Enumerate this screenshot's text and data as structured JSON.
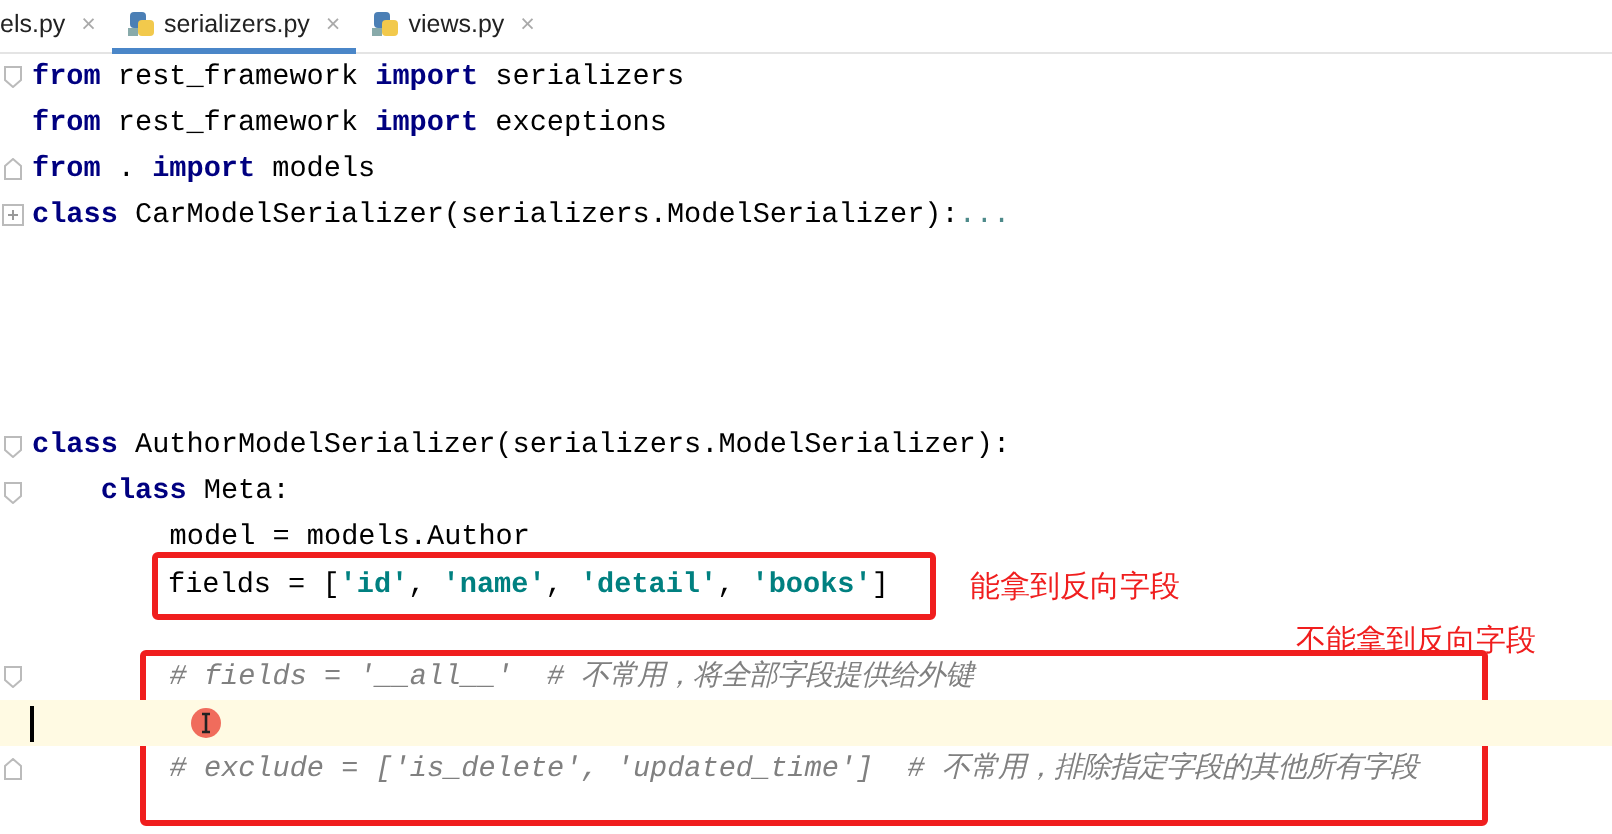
{
  "tabs": [
    {
      "label": "els.py",
      "selected": false,
      "close": "×"
    },
    {
      "label": "serializers.py",
      "selected": true,
      "icon": true,
      "close": "×"
    },
    {
      "label": "views.py",
      "selected": false,
      "icon": true,
      "close": "×"
    }
  ],
  "editor": {
    "lines": [
      {
        "kind": "code",
        "fold_start": true,
        "tokens": [
          {
            "kind": "kw",
            "text": "from"
          },
          {
            "kind": "plain",
            "text": " rest_framework "
          },
          {
            "kind": "kw",
            "text": "import"
          },
          {
            "kind": "plain",
            "text": " serializers"
          }
        ]
      },
      {
        "kind": "code",
        "tokens": [
          {
            "kind": "kw",
            "text": "from"
          },
          {
            "kind": "plain",
            "text": " rest_framework "
          },
          {
            "kind": "kw",
            "text": "import"
          },
          {
            "kind": "plain",
            "text": " exceptions"
          }
        ]
      },
      {
        "kind": "code",
        "fold_end": true,
        "tokens": [
          {
            "kind": "kw",
            "text": "from"
          },
          {
            "kind": "plain",
            "text": " . "
          },
          {
            "kind": "kw",
            "text": "import"
          },
          {
            "kind": "plain",
            "text": " models"
          }
        ]
      },
      {
        "kind": "code",
        "collapsed": true,
        "tokens": [
          {
            "kind": "kw",
            "text": "class"
          },
          {
            "kind": "plain",
            "text": " CarModelSerializer(serializers.ModelSerializer):"
          },
          {
            "kind": "folded",
            "text": "..."
          }
        ]
      },
      {
        "kind": "blank"
      },
      {
        "kind": "blank"
      },
      {
        "kind": "blank"
      },
      {
        "kind": "blank"
      },
      {
        "kind": "code",
        "fold_start": true,
        "tokens": [
          {
            "kind": "kw",
            "text": "class"
          },
          {
            "kind": "plain",
            "text": " AuthorModelSerializer(serializers.ModelSerializer):"
          }
        ],
        "children": [
          {
            "kind": "code",
            "fold_start": true,
            "tokens": [
              {
                "kind": "kw",
                "text": "class"
              },
              {
                "kind": "plain",
                "text": " Meta:"
              }
            ],
            "children": [
              {
                "kind": "code",
                "tokens": [
                  {
                    "kind": "plain",
                    "text": "model = models.Author"
                  }
                ]
              },
              {
                "kind": "code",
                "annotation": {
                  "label": "能拿到反向字段"
                },
                "tokens": [
                  {
                    "kind": "plain",
                    "text": "fields = ["
                  },
                  {
                    "kind": "str",
                    "text": "'id'"
                  },
                  {
                    "kind": "plain",
                    "text": ", "
                  },
                  {
                    "kind": "str",
                    "text": "'name'"
                  },
                  {
                    "kind": "plain",
                    "text": ", "
                  },
                  {
                    "kind": "str",
                    "text": "'detail'"
                  },
                  {
                    "kind": "plain",
                    "text": ", "
                  },
                  {
                    "kind": "str",
                    "text": "'books'"
                  },
                  {
                    "kind": "plain",
                    "text": "]"
                  }
                ]
              },
              {
                "kind": "blank"
              },
              {
                "kind": "code",
                "fold_start": true,
                "tokens": [
                  {
                    "kind": "comment",
                    "text": "# fields = '__all__'  # 不常用，将全部字段提供给外键"
                  }
                ]
              },
              {
                "kind": "blank",
                "current": true
              },
              {
                "kind": "code",
                "fold_end": true,
                "tokens": [
                  {
                    "kind": "comment",
                    "text": "# exclude = ['is_delete', 'updated_time']  # 不常用，排除指定字段的其他所有字段"
                  }
                ]
              }
            ]
          }
        ]
      }
    ]
  },
  "annotations": [
    {
      "label": "不能拿到反向字段"
    }
  ]
}
